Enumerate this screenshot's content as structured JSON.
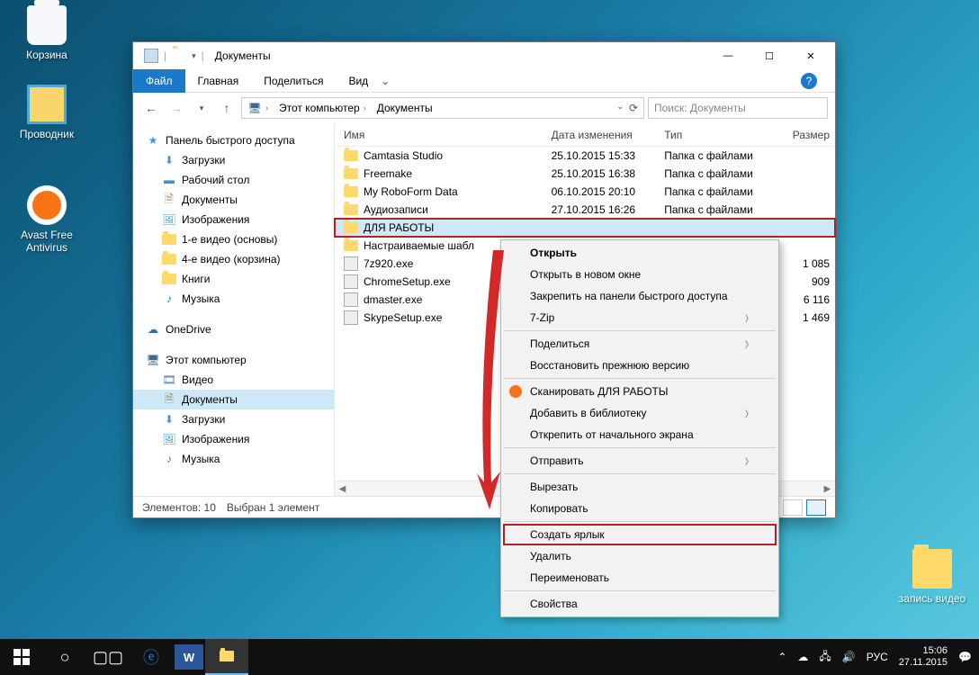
{
  "desktop": {
    "recycle": "Корзина",
    "explorer": "Проводник",
    "avast": "Avast Free Antivirus",
    "video_rec": "запись видео"
  },
  "window": {
    "title": "Документы",
    "tabs": {
      "file": "Файл",
      "home": "Главная",
      "share": "Поделиться",
      "view": "Вид"
    },
    "breadcrumb": {
      "pc": "Этот компьютер",
      "docs": "Документы"
    },
    "search_placeholder": "Поиск: Документы",
    "columns": {
      "name": "Имя",
      "date": "Дата изменения",
      "type": "Тип",
      "size": "Размер"
    },
    "files": [
      {
        "name": "Camtasia Studio",
        "date": "25.10.2015 15:33",
        "type": "Папка с файлами",
        "size": "",
        "kind": "folder"
      },
      {
        "name": "Freemake",
        "date": "25.10.2015 16:38",
        "type": "Папка с файлами",
        "size": "",
        "kind": "folder"
      },
      {
        "name": "My RoboForm Data",
        "date": "06.10.2015 20:10",
        "type": "Папка с файлами",
        "size": "",
        "kind": "folder"
      },
      {
        "name": "Аудиозаписи",
        "date": "27.10.2015 16:26",
        "type": "Папка с файлами",
        "size": "",
        "kind": "folder"
      },
      {
        "name": "ДЛЯ РАБОТЫ",
        "date": "",
        "type": "",
        "size": "",
        "kind": "folder",
        "sel": true
      },
      {
        "name": "Настраиваемые шабл",
        "date": "",
        "type": "",
        "size": "",
        "kind": "folder"
      },
      {
        "name": "7z920.exe",
        "date": "",
        "type": "",
        "size": "1 085",
        "kind": "exe"
      },
      {
        "name": "ChromeSetup.exe",
        "date": "",
        "type": "",
        "size": "909",
        "kind": "exe"
      },
      {
        "name": "dmaster.exe",
        "date": "",
        "type": "",
        "size": "6 116",
        "kind": "exe"
      },
      {
        "name": "SkypeSetup.exe",
        "date": "",
        "type": "",
        "size": "1 469",
        "kind": "exe"
      }
    ],
    "status": {
      "items": "Элементов: 10",
      "sel": "Выбран 1 элемент"
    }
  },
  "nav": {
    "quick": "Панель быстрого доступа",
    "downloads": "Загрузки",
    "desktop": "Рабочий стол",
    "documents": "Документы",
    "pictures": "Изображения",
    "vid1": "1-е видео (основы)",
    "vid4": "4-е видео (корзина)",
    "books": "Книги",
    "music": "Музыка",
    "onedrive": "OneDrive",
    "this_pc": "Этот компьютер",
    "video": "Видео",
    "documents2": "Документы",
    "downloads2": "Загрузки",
    "pictures2": "Изображения",
    "music2": "Музыка"
  },
  "ctx": {
    "open": "Открыть",
    "open_new": "Открыть в новом окне",
    "pin_quick": "Закрепить на панели быстрого доступа",
    "zip": "7-Zip",
    "share": "Поделиться",
    "restore": "Восстановить прежнюю версию",
    "scan": "Сканировать ДЛЯ РАБОТЫ",
    "library": "Добавить в библиотеку",
    "unpin": "Открепить от начального экрана",
    "send": "Отправить",
    "cut": "Вырезать",
    "copy": "Копировать",
    "shortcut": "Создать ярлык",
    "delete": "Удалить",
    "rename": "Переименовать",
    "props": "Свойства"
  },
  "taskbar": {
    "lang": "РУС",
    "time": "15:06",
    "date": "27.11.2015"
  }
}
